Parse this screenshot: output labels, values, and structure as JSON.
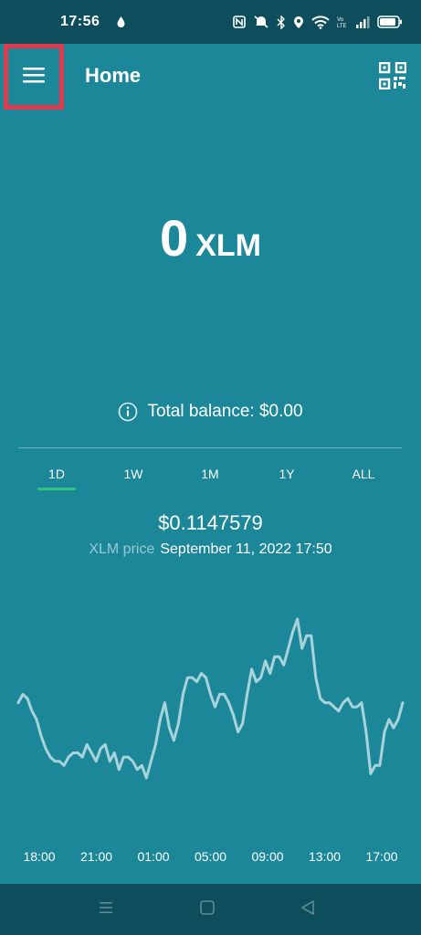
{
  "status_bar": {
    "time": "17:56",
    "icons": [
      "drop-icon",
      "nfc-icon",
      "mute-icon",
      "bluetooth-icon",
      "location-icon",
      "wifi-icon",
      "volte-icon",
      "signal-icon",
      "battery-icon"
    ]
  },
  "app_bar": {
    "title": "Home",
    "menu_icon": "menu-icon",
    "qr_icon": "qr-code-icon",
    "highlight_color": "#e03a4e"
  },
  "balance": {
    "amount": "0",
    "unit": "XLM",
    "total_label": "Total balance: $0.00"
  },
  "tabs": {
    "items": [
      {
        "label": "1D",
        "active": true
      },
      {
        "label": "1W",
        "active": false
      },
      {
        "label": "1M",
        "active": false
      },
      {
        "label": "1Y",
        "active": false
      },
      {
        "label": "ALL",
        "active": false
      }
    ],
    "active_color": "#2ec27e"
  },
  "price": {
    "value": "$0.1147579",
    "label": "XLM price",
    "datetime": "September 11, 2022 17:50"
  },
  "chart_data": {
    "type": "line",
    "x_tick_labels": [
      "18:00",
      "21:00",
      "01:00",
      "05:00",
      "09:00",
      "13:00",
      "17:00"
    ],
    "series": [
      {
        "values": [
          0.1137,
          0.1139,
          0.1138,
          0.1135,
          0.1133,
          0.1129,
          0.1126,
          0.1124,
          0.1123,
          0.1123,
          0.1122,
          0.1124,
          0.1125,
          0.1125,
          0.1124,
          0.1127,
          0.1125,
          0.1123,
          0.1126,
          0.1127,
          0.1123,
          0.1125,
          0.1121,
          0.1124,
          0.1124,
          0.1123,
          0.1121,
          0.1122,
          0.1119,
          0.1123,
          0.1127,
          0.1133,
          0.1137,
          0.1131,
          0.1128,
          0.1132,
          0.1139,
          0.1143,
          0.1143,
          0.1142,
          0.1144,
          0.1143,
          0.1139,
          0.1136,
          0.1139,
          0.1139,
          0.1137,
          0.1134,
          0.113,
          0.1132,
          0.1139,
          0.1145,
          0.1142,
          0.1143,
          0.1147,
          0.1144,
          0.1148,
          0.1148,
          0.1146,
          0.115,
          0.1154,
          0.1157,
          0.115,
          0.1153,
          0.1153,
          0.1143,
          0.1138,
          0.1137,
          0.1137,
          0.1136,
          0.1135,
          0.1137,
          0.1138,
          0.1136,
          0.1136,
          0.1137,
          0.113,
          0.112,
          0.1122,
          0.1122,
          0.113,
          0.1133,
          0.1131,
          0.1133,
          0.1137
        ]
      }
    ],
    "line_color": "#a9d3db"
  },
  "nav_bar": {
    "icons": [
      "recents-icon",
      "home-icon",
      "back-icon"
    ]
  }
}
